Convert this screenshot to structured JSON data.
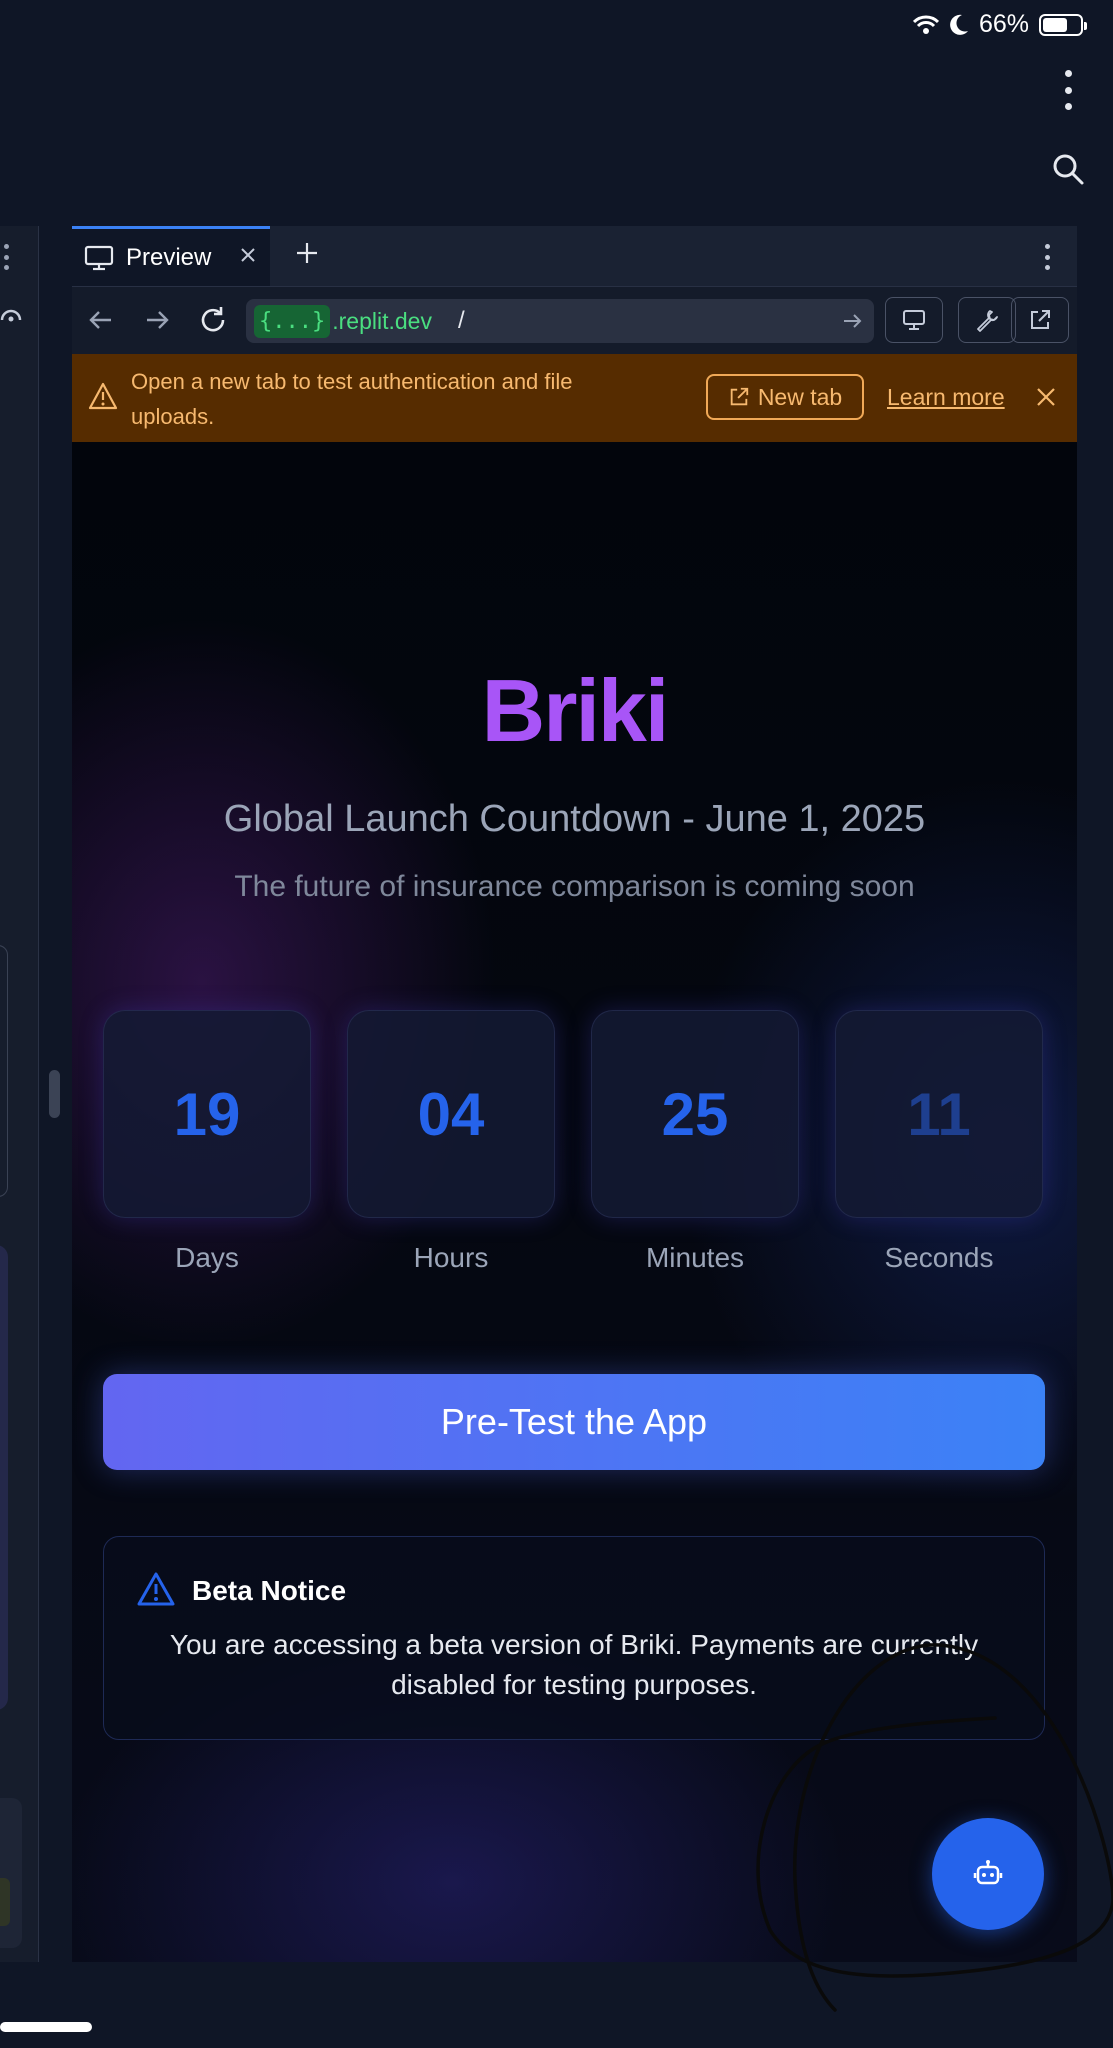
{
  "status_bar": {
    "battery_text": "66%",
    "battery_level": 0.66
  },
  "browser": {
    "tab_label": "Preview",
    "url_token": "{...}",
    "url_domain": ".replit.dev",
    "url_path": "/"
  },
  "banner": {
    "message": "Open a new tab to test authentication and file uploads.",
    "new_tab_label": "New tab",
    "learn_more_label": "Learn more"
  },
  "page": {
    "brand": "Briki",
    "subtitle": "Global Launch Countdown - June 1, 2025",
    "tagline": "The future of insurance comparison is coming soon",
    "countdown": [
      {
        "value": "19",
        "label": "Days"
      },
      {
        "value": "04",
        "label": "Hours"
      },
      {
        "value": "25",
        "label": "Minutes"
      },
      {
        "value": "11",
        "label": "Seconds"
      }
    ],
    "cta_label": "Pre-Test the App",
    "beta_title": "Beta Notice",
    "beta_text": "You are accessing a beta version of Briki. Payments are currently disabled for testing purposes."
  },
  "colors": {
    "background": "#0f1626",
    "accent_blue": "#2563eb",
    "brand_purple": "#a855f7",
    "banner_bg": "#562c00",
    "banner_text": "#f7b96f",
    "url_green": "#4ade80"
  },
  "icons": {
    "status": [
      "wifi-icon",
      "moon-icon",
      "battery-icon"
    ],
    "top": [
      "more-vertical-icon",
      "search-icon"
    ],
    "tab": [
      "monitor-icon",
      "close-icon",
      "plus-icon",
      "more-vertical-icon"
    ],
    "nav": [
      "arrow-left-icon",
      "arrow-right-icon",
      "reload-icon",
      "arrow-right-icon",
      "monitor-icon",
      "wrench-icon",
      "external-link-icon"
    ],
    "banner": [
      "warning-icon",
      "external-link-icon",
      "close-icon"
    ],
    "page": [
      "warning-icon",
      "bot-icon"
    ]
  }
}
